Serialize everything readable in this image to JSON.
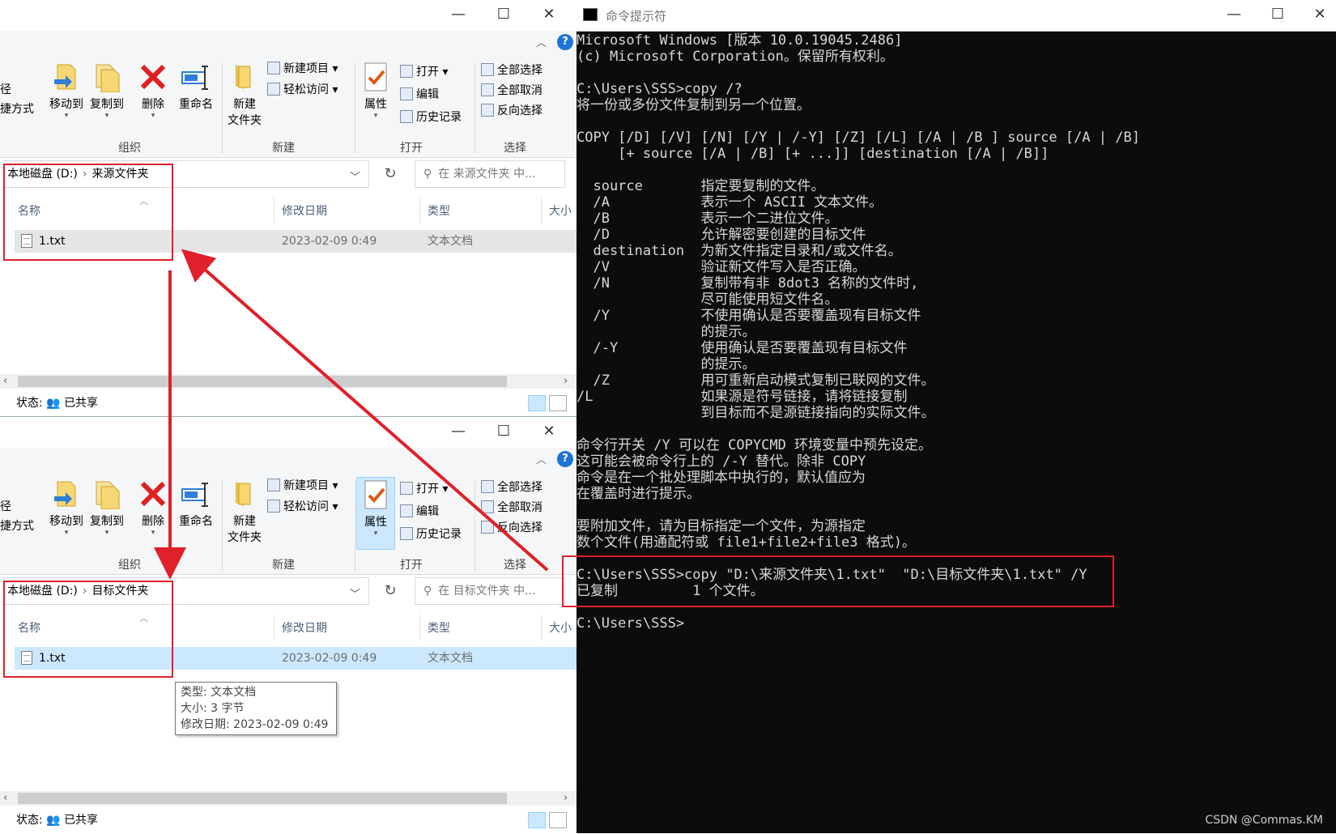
{
  "explorer_top": {
    "ribbon": {
      "left_labels": [
        "径",
        "捷方式"
      ],
      "move_to": "移动到",
      "copy_to": "复制到",
      "delete": "删除",
      "rename": "重命名",
      "new_folder_l1": "新建",
      "new_folder_l2": "文件夹",
      "new_item": "新建项目",
      "easy_access": "轻松访问",
      "properties": "属性",
      "open": "打开",
      "edit": "编辑",
      "history": "历史记录",
      "select_all": "全部选择",
      "select_none": "全部取消",
      "invert_selection": "反向选择",
      "group_organize": "组织",
      "group_new": "新建",
      "group_open": "打开",
      "group_select": "选择",
      "help": "?"
    },
    "address": {
      "drive": "本地磁盘 (D:)",
      "folder": "来源文件夹"
    },
    "search_placeholder": "在 来源文件夹 中...",
    "columns": {
      "name": "名称",
      "date": "修改日期",
      "type": "类型",
      "size": "大小"
    },
    "files": [
      {
        "name": "1.txt",
        "date": "2023-02-09 0:49",
        "type": "文本文档"
      }
    ],
    "status_label": "状态:",
    "status_value": "已共享"
  },
  "explorer_bottom": {
    "ribbon": {
      "left_labels": [
        "径",
        "捷方式"
      ],
      "move_to": "移动到",
      "copy_to": "复制到",
      "delete": "删除",
      "rename": "重命名",
      "new_folder_l1": "新建",
      "new_folder_l2": "文件夹",
      "new_item": "新建项目",
      "easy_access": "轻松访问",
      "properties": "属性",
      "open": "打开",
      "edit": "编辑",
      "history": "历史记录",
      "select_all": "全部选择",
      "select_none": "全部取消",
      "invert_selection": "反向选择",
      "group_organize": "组织",
      "group_new": "新建",
      "group_open": "打开",
      "group_select": "选择",
      "help": "?"
    },
    "address": {
      "drive": "本地磁盘 (D:)",
      "folder": "目标文件夹"
    },
    "search_placeholder": "在 目标文件夹 中...",
    "columns": {
      "name": "名称",
      "date": "修改日期",
      "type": "类型",
      "size": "大小"
    },
    "files": [
      {
        "name": "1.txt",
        "date": "2023-02-09 0:49",
        "type": "文本文档"
      }
    ],
    "tooltip": [
      "类型: 文本文档",
      "大小: 3 字节",
      "修改日期: 2023-02-09 0:49"
    ],
    "status_label": "状态:",
    "status_value": "已共享"
  },
  "window_controls": {
    "minimize": "—",
    "maximize": "☐",
    "close": "✕"
  },
  "cmd": {
    "title": "命令提示符",
    "lines": [
      "Microsoft Windows [版本 10.0.19045.2486]",
      "(c) Microsoft Corporation。保留所有权利。",
      "",
      "C:\\Users\\SSS>copy /?",
      "将一份或多份文件复制到另一个位置。",
      "",
      "COPY [/D] [/V] [/N] [/Y | /-Y] [/Z] [/L] [/A | /B ] source [/A | /B]",
      "     [+ source [/A | /B] [+ ...]] [destination [/A | /B]]",
      "",
      "  source       指定要复制的文件。",
      "  /A           表示一个 ASCII 文本文件。",
      "  /B           表示一个二进位文件。",
      "  /D           允许解密要创建的目标文件",
      "  destination  为新文件指定目录和/或文件名。",
      "  /V           验证新文件写入是否正确。",
      "  /N           复制带有非 8dot3 名称的文件时,",
      "               尽可能使用短文件名。",
      "  /Y           不使用确认是否要覆盖现有目标文件",
      "               的提示。",
      "  /-Y          使用确认是否要覆盖现有目标文件",
      "               的提示。",
      "  /Z           用可重新启动模式复制已联网的文件。",
      "/L             如果源是符号链接，请将链接复制",
      "               到目标而不是源链接指向的实际文件。",
      "",
      "命令行开关 /Y 可以在 COPYCMD 环境变量中预先设定。",
      "这可能会被命令行上的 /-Y 替代。除非 COPY",
      "命令是在一个批处理脚本中执行的，默认值应为",
      "在覆盖时进行提示。",
      "",
      "要附加文件，请为目标指定一个文件，为源指定",
      "数个文件(用通配符或 file1+file2+file3 格式)。",
      "",
      "C:\\Users\\SSS>copy \"D:\\来源文件夹\\1.txt\"  \"D:\\目标文件夹\\1.txt\" /Y",
      "已复制         1 个文件。",
      "",
      "C:\\Users\\SSS>"
    ]
  },
  "watermark": "CSDN @Commas.KM",
  "colors": {
    "annotation_red": "#e0202a",
    "cmd_bg": "#0c0c0c",
    "selected_row": "#cce8ff",
    "hover_row": "#e5e5e5"
  }
}
